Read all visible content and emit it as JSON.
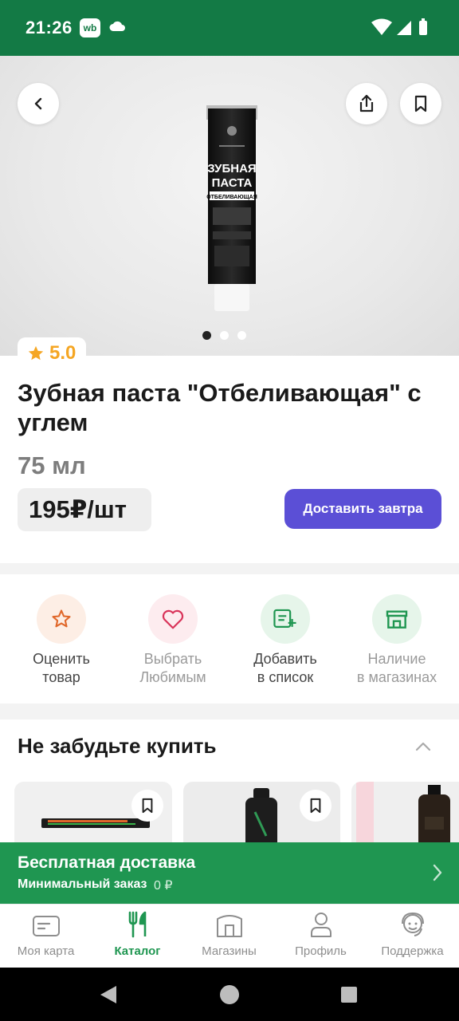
{
  "status_bar": {
    "time": "21:26",
    "wb_badge": "wb"
  },
  "product": {
    "rating": "5.0",
    "title": "Зубная паста \"Отбеливающая\" с углем",
    "volume": "75 мл",
    "price": "195₽/шт",
    "deliver_label": "Доставить завтра",
    "package_text": {
      "line1": "ЗУБНАЯ",
      "line2": "ПАСТА",
      "line3": "ОТБЕЛИВАЮЩАЯ"
    },
    "image_dots": 3,
    "active_dot": 1
  },
  "actions": [
    {
      "line1": "Оценить",
      "line2": "товар",
      "icon": "star-outline-icon"
    },
    {
      "line1": "Выбрать",
      "line2": "Любимым",
      "icon": "heart-outline-icon"
    },
    {
      "line1": "Добавить",
      "line2": "в список",
      "icon": "list-add-icon"
    },
    {
      "line1": "Наличие",
      "line2": "в магазинах",
      "icon": "store-icon"
    }
  ],
  "recommendations": {
    "title": "Не забудьте купить"
  },
  "delivery_banner": {
    "title": "Бесплатная доставка",
    "subtitle": "Минимальный заказ",
    "amount": "0 ₽"
  },
  "tabs": [
    {
      "label": "Моя карта",
      "icon": "card-icon",
      "active": false
    },
    {
      "label": "Каталог",
      "icon": "fork-knife-icon",
      "active": true
    },
    {
      "label": "Магазины",
      "icon": "store-icon",
      "active": false
    },
    {
      "label": "Профиль",
      "icon": "profile-icon",
      "active": false
    },
    {
      "label": "Поддержка",
      "icon": "support-icon",
      "active": false
    }
  ],
  "colors": {
    "brand_green": "#137a45",
    "banner_green": "#1f9651",
    "accent_purple": "#5b4fd6",
    "rating_orange": "#f5a623"
  }
}
